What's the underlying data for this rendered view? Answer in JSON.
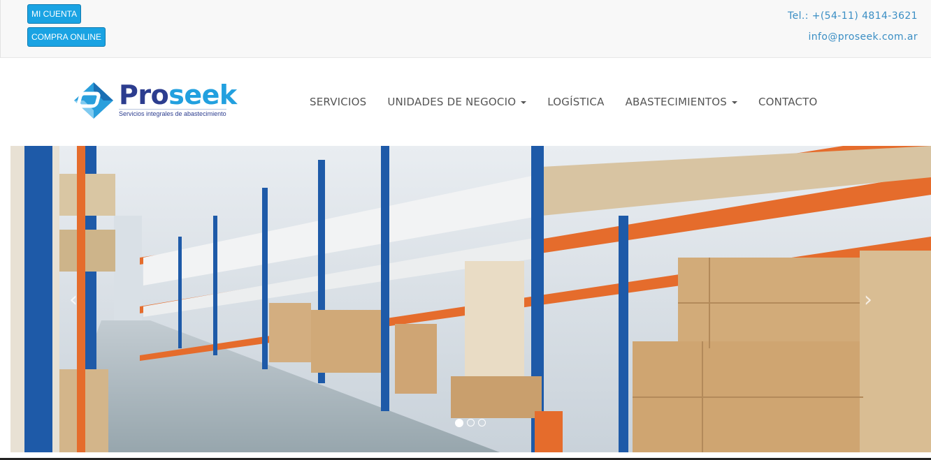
{
  "topbar": {
    "account_label": "MI CUENTA",
    "shop_label": "COMPRA ONLINE",
    "phone": "Tel.: +(54-11) 4814-3621",
    "email": "info@proseek.com.ar"
  },
  "logo": {
    "name_part1": "Pro",
    "name_part2": "seek",
    "tagline": "Servicios integrales de abastecimiento"
  },
  "nav": {
    "items": [
      {
        "label": "SERVICIOS",
        "dropdown": false
      },
      {
        "label": "UNIDADES DE NEGOCIO",
        "dropdown": true
      },
      {
        "label": "LOGÍSTICA",
        "dropdown": false
      },
      {
        "label": "ABASTECIMIENTOS",
        "dropdown": true
      },
      {
        "label": "CONTACTO",
        "dropdown": false
      }
    ]
  },
  "carousel": {
    "prev_icon": "chevron-left-icon",
    "next_icon": "chevron-right-icon",
    "prev_glyph": "‹",
    "next_glyph": "›",
    "slide_count": 3,
    "active_slide": 1
  },
  "colors": {
    "accent": "#1aa3e3",
    "link": "#3a8ec4",
    "brand_dark": "#2c3d8f",
    "brand_light": "#22a0df",
    "nav_text": "#555555"
  }
}
